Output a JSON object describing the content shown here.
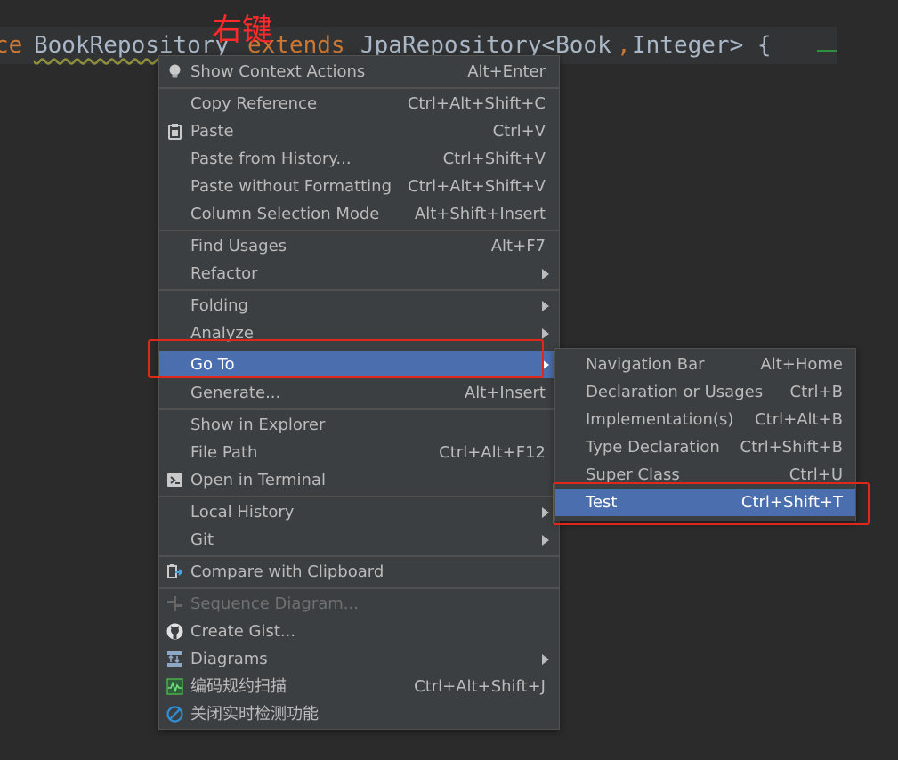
{
  "annotation": "右键",
  "code": {
    "prefix": "ce",
    "name": "BookRepository",
    "extends_kw": "extends",
    "base": "JpaRepository<Book",
    "comma": ",",
    "rest": "Integer> {"
  },
  "main_menu": {
    "show_context_actions": {
      "label": "Show Context Actions",
      "shortcut": "Alt+Enter"
    },
    "copy_reference": {
      "label": "Copy Reference",
      "shortcut": "Ctrl+Alt+Shift+C"
    },
    "paste": {
      "label": "Paste",
      "shortcut": "Ctrl+V"
    },
    "paste_history": {
      "label": "Paste from History...",
      "shortcut": "Ctrl+Shift+V"
    },
    "paste_no_format": {
      "label": "Paste without Formatting",
      "shortcut": "Ctrl+Alt+Shift+V"
    },
    "column_selection": {
      "label": "Column Selection Mode",
      "shortcut": "Alt+Shift+Insert"
    },
    "find_usages": {
      "label": "Find Usages",
      "shortcut": "Alt+F7"
    },
    "refactor": {
      "label": "Refactor"
    },
    "folding": {
      "label": "Folding"
    },
    "analyze": {
      "label": "Analyze"
    },
    "go_to": {
      "label": "Go To"
    },
    "generate": {
      "label": "Generate...",
      "shortcut": "Alt+Insert"
    },
    "show_in_explorer": {
      "label": "Show in Explorer"
    },
    "file_path": {
      "label": "File Path",
      "shortcut": "Ctrl+Alt+F12"
    },
    "open_terminal": {
      "label": "Open in Terminal"
    },
    "local_history": {
      "label": "Local History"
    },
    "git": {
      "label": "Git"
    },
    "compare_clipboard": {
      "label": "Compare with Clipboard"
    },
    "sequence_diagram": {
      "label": "Sequence Diagram..."
    },
    "create_gist": {
      "label": "Create Gist..."
    },
    "diagrams": {
      "label": "Diagrams"
    },
    "code_scan": {
      "label": "编码规约扫描",
      "shortcut": "Ctrl+Alt+Shift+J"
    },
    "close_realtime": {
      "label": "关闭实时检测功能"
    }
  },
  "sub_menu": {
    "navigation_bar": {
      "label": "Navigation Bar",
      "shortcut": "Alt+Home"
    },
    "declaration": {
      "label": "Declaration or Usages",
      "shortcut": "Ctrl+B"
    },
    "implementation": {
      "label": "Implementation(s)",
      "shortcut": "Ctrl+Alt+B"
    },
    "type_declaration": {
      "label": "Type Declaration",
      "shortcut": "Ctrl+Shift+B"
    },
    "super_class": {
      "label": "Super Class",
      "shortcut": "Ctrl+U"
    },
    "test": {
      "label": "Test",
      "shortcut": "Ctrl+Shift+T"
    }
  },
  "colors": {
    "selection": "#4b6eaf",
    "menu_bg": "#3c3f41",
    "highlight_box": "#e0281a",
    "annotation": "#ff2a2a"
  }
}
